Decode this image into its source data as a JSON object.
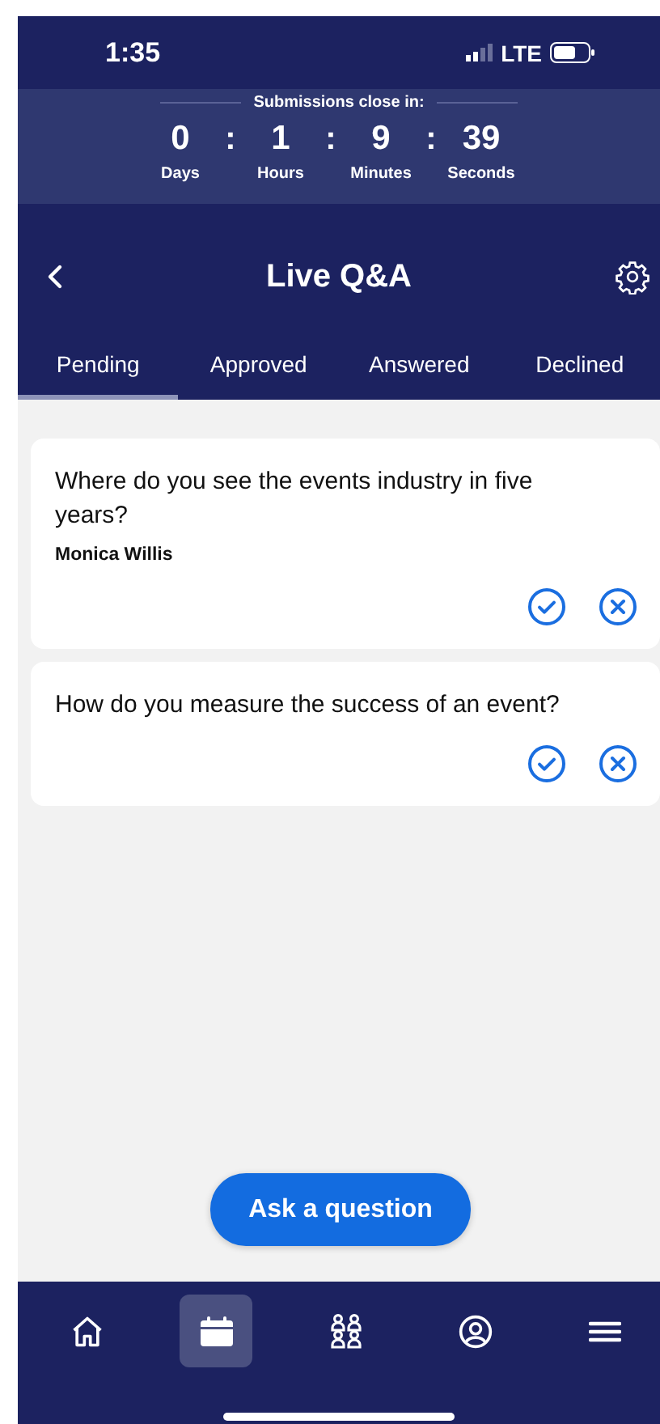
{
  "status_bar": {
    "time": "1:35",
    "network": "LTE"
  },
  "countdown": {
    "label": "Submissions close in:",
    "units": [
      {
        "value": "0",
        "label": "Days"
      },
      {
        "value": "1",
        "label": "Hours"
      },
      {
        "value": "9",
        "label": "Minutes"
      },
      {
        "value": "39",
        "label": "Seconds"
      }
    ],
    "separator": ":"
  },
  "header": {
    "title": "Live Q&A"
  },
  "tabs": [
    {
      "label": "Pending",
      "selected": true
    },
    {
      "label": "Approved",
      "selected": false
    },
    {
      "label": "Answered",
      "selected": false
    },
    {
      "label": "Declined",
      "selected": false
    }
  ],
  "questions": [
    {
      "text": "Where do you see the events industry in five years?",
      "author": "Monica Willis"
    },
    {
      "text": "How do you measure the success of an event?"
    }
  ],
  "ask_button": "Ask a question",
  "nav": [
    {
      "kind": "home",
      "selected": false
    },
    {
      "kind": "calendar",
      "selected": true
    },
    {
      "kind": "people",
      "selected": false
    },
    {
      "kind": "profile",
      "selected": false
    },
    {
      "kind": "menu",
      "selected": false
    }
  ]
}
